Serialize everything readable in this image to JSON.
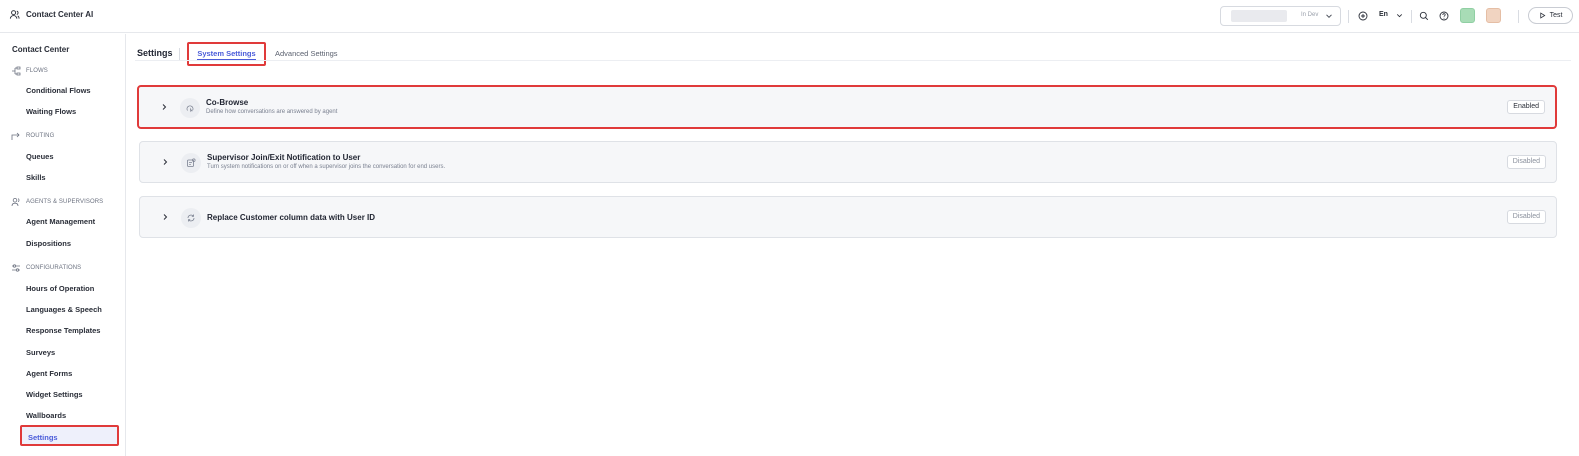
{
  "app": {
    "title": "Contact Center AI"
  },
  "topbar": {
    "env_label": "In Dev",
    "language": "En",
    "test_label": "Test"
  },
  "sidebar": {
    "header": "Contact Center",
    "sections": [
      {
        "label": "FLOWS",
        "icon": "flow-icon",
        "items": [
          "Conditional Flows",
          "Waiting Flows"
        ]
      },
      {
        "label": "ROUTING",
        "icon": "routing-icon",
        "items": [
          "Queues",
          "Skills"
        ]
      },
      {
        "label": "AGENTS & SUPERVISORS",
        "icon": "agents-icon",
        "items": [
          "Agent Management",
          "Dispositions"
        ]
      },
      {
        "label": "CONFIGURATIONS",
        "icon": "config-icon",
        "items": [
          "Hours of Operation",
          "Languages & Speech",
          "Response Templates",
          "Surveys",
          "Agent Forms",
          "Widget Settings",
          "Wallboards",
          "Settings"
        ]
      }
    ],
    "active_item": "Settings"
  },
  "main": {
    "title": "Settings",
    "tabs": [
      {
        "label": "System Settings",
        "active": true
      },
      {
        "label": "Advanced Settings",
        "active": false
      }
    ],
    "cards": [
      {
        "title": "Co-Browse",
        "description": "Define how conversations are answered by agent",
        "status": "Enabled",
        "icon": "cobrowse-icon"
      },
      {
        "title": "Supervisor Join/Exit Notification to User",
        "description": "Turn system notifications on or off when a supervisor joins the conversation for end users.",
        "status": "Disabled",
        "icon": "notification-icon"
      },
      {
        "title": "Replace Customer column data with User ID",
        "description": "",
        "status": "Disabled",
        "icon": "refresh-icon"
      }
    ]
  },
  "colors": {
    "accent": "#4a5bd9",
    "highlight": "#e03a3a"
  }
}
